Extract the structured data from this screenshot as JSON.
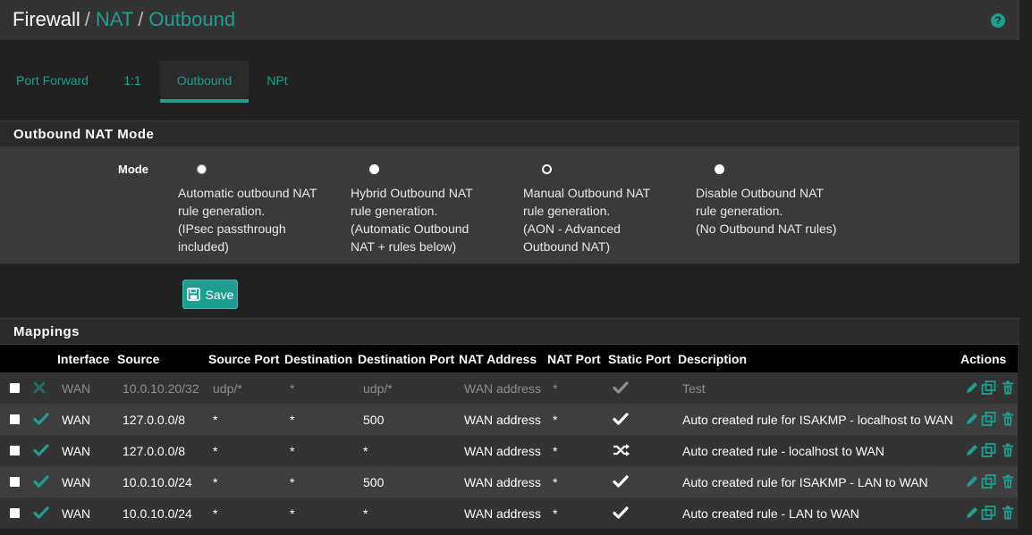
{
  "breadcrumb": {
    "first": "Firewall",
    "sep1": "/",
    "second": "NAT",
    "sep2": "/",
    "third": "Outbound"
  },
  "tabs": [
    {
      "label": "Port Forward"
    },
    {
      "label": "1:1"
    },
    {
      "label": "Outbound",
      "active": true
    },
    {
      "label": "NPt"
    }
  ],
  "mode_panel": {
    "title": "Outbound NAT Mode",
    "label": "Mode",
    "options": [
      {
        "line1": "Automatic outbound NAT",
        "line2": "rule generation.",
        "line3": "(IPsec passthrough",
        "line4": "included)",
        "selected": false
      },
      {
        "line1": "Hybrid Outbound NAT",
        "line2": "rule generation.",
        "line3": "(Automatic Outbound",
        "line4": "NAT + rules below)",
        "selected": false
      },
      {
        "line1": "Manual Outbound NAT",
        "line2": "rule generation.",
        "line3": "(AON - Advanced",
        "line4": "Outbound NAT)",
        "selected": true
      },
      {
        "line1": "Disable Outbound NAT",
        "line2": "rule generation.",
        "line3": "(No Outbound NAT rules)",
        "line4": "",
        "selected": false
      }
    ]
  },
  "save_label": "Save",
  "mappings": {
    "title": "Mappings",
    "columns": {
      "interface": "Interface",
      "source": "Source",
      "source_port": "Source Port",
      "destination": "Destination",
      "destination_port": "Destination Port",
      "nat_address": "NAT Address",
      "nat_port": "NAT Port",
      "static_port": "Static Port",
      "description": "Description",
      "actions": "Actions"
    },
    "rows": [
      {
        "enabled": false,
        "interface": "WAN",
        "source": "10.0.10.20/32",
        "source_port": "udp/*",
        "destination": "*",
        "destination_port": "udp/*",
        "nat_address": "WAN address",
        "nat_port": "*",
        "static_port": "check-icon",
        "description": "Test"
      },
      {
        "enabled": true,
        "interface": "WAN",
        "source": "127.0.0.0/8",
        "source_port": "*",
        "destination": "*",
        "destination_port": "500",
        "nat_address": "WAN address",
        "nat_port": "*",
        "static_port": "check-icon",
        "description": "Auto created rule for ISAKMP - localhost to WAN"
      },
      {
        "enabled": true,
        "interface": "WAN",
        "source": "127.0.0.0/8",
        "source_port": "*",
        "destination": "*",
        "destination_port": "*",
        "nat_address": "WAN address",
        "nat_port": "*",
        "static_port": "shuffle-icon",
        "description": "Auto created rule - localhost to WAN"
      },
      {
        "enabled": true,
        "interface": "WAN",
        "source": "10.0.10.0/24",
        "source_port": "*",
        "destination": "*",
        "destination_port": "500",
        "nat_address": "WAN address",
        "nat_port": "*",
        "static_port": "check-icon",
        "description": "Auto created rule for ISAKMP - LAN to WAN"
      },
      {
        "enabled": true,
        "interface": "WAN",
        "source": "10.0.10.0/24",
        "source_port": "*",
        "destination": "*",
        "destination_port": "*",
        "nat_address": "WAN address",
        "nat_port": "*",
        "static_port": "check-icon",
        "description": "Auto created rule - LAN to WAN"
      }
    ]
  },
  "colors": {
    "accent": "#1e9e8e",
    "background": "#212121",
    "panel": "#3a3a3a"
  }
}
